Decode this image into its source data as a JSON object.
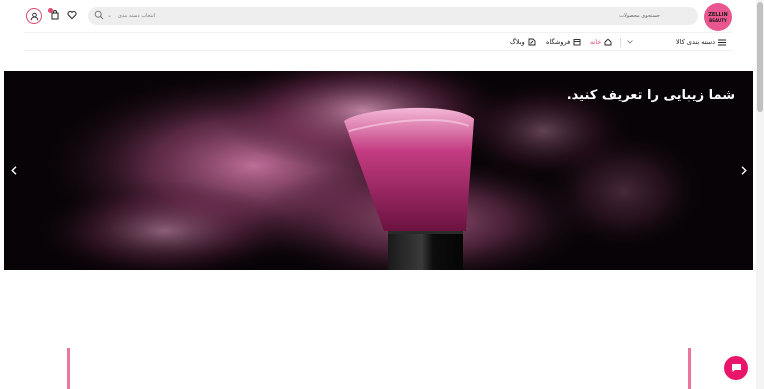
{
  "header": {
    "logo_line1": "ZELLIN",
    "logo_line2": "BEAUTY",
    "search_placeholder": "جستجوی محصولات",
    "category_select": "انتخاب دسته بندی"
  },
  "nav": {
    "categories_label": "دسته بندی کالا",
    "items": [
      {
        "label": "خانه",
        "icon": "home-icon",
        "active": true
      },
      {
        "label": "فروشگاه",
        "icon": "store-icon",
        "active": false
      },
      {
        "label": "وبلاگ",
        "icon": "blog-icon",
        "active": false
      }
    ]
  },
  "hero": {
    "headline": "شما زیبایی را تعریف کنید."
  },
  "colors": {
    "accent": "#e2486f",
    "chat": "#e8156a"
  }
}
